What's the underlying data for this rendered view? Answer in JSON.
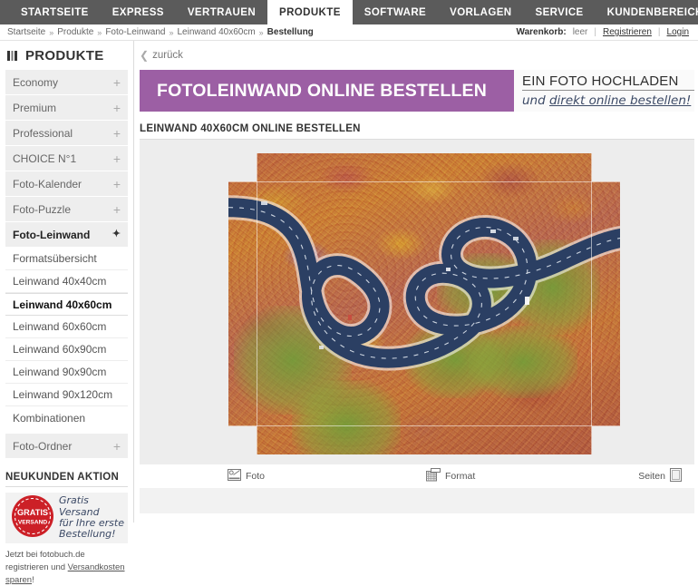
{
  "topnav": {
    "items": [
      {
        "label": "STARTSEITE",
        "active": false
      },
      {
        "label": "EXPRESS",
        "active": false
      },
      {
        "label": "VERTRAUEN",
        "active": false
      },
      {
        "label": "PRODUKTE",
        "active": true
      },
      {
        "label": "SOFTWARE",
        "active": false
      },
      {
        "label": "VORLAGEN",
        "active": false
      },
      {
        "label": "SERVICE",
        "active": false
      }
    ],
    "account_label": "KUNDENBEREICH"
  },
  "breadcrumb": {
    "items": [
      "Startseite",
      "Produkte",
      "Foto-Leinwand",
      "Leinwand 40x60cm",
      "Bestellung"
    ],
    "separator": "»",
    "cart_label": "Warenkorb:",
    "cart_value": "leer",
    "register_label": "Registrieren",
    "login_label": "Login",
    "divider": "|"
  },
  "sidebar": {
    "title": "PRODUKTE",
    "categories": [
      {
        "label": "Economy",
        "expand": "+",
        "open": false
      },
      {
        "label": "Premium",
        "expand": "+",
        "open": false
      },
      {
        "label": "Professional",
        "expand": "+",
        "open": false
      },
      {
        "label": "CHOICE N°1",
        "expand": "+",
        "open": false
      },
      {
        "label": "Foto-Kalender",
        "expand": "+",
        "open": false
      },
      {
        "label": "Foto-Puzzle",
        "expand": "+",
        "open": false
      },
      {
        "label": "Foto-Leinwand",
        "expand": "✦",
        "open": true
      }
    ],
    "subitems": [
      {
        "label": "Formatsübersicht",
        "selected": false
      },
      {
        "label": "Leinwand 40x40cm",
        "selected": false
      },
      {
        "label": "Leinwand 40x60cm",
        "selected": true
      },
      {
        "label": "Leinwand 60x60cm",
        "selected": false
      },
      {
        "label": "Leinwand 60x90cm",
        "selected": false
      },
      {
        "label": "Leinwand 90x90cm",
        "selected": false
      },
      {
        "label": "Leinwand 90x120cm",
        "selected": false
      },
      {
        "label": "Kombinationen",
        "selected": false
      }
    ],
    "trailing_category": {
      "label": "Foto-Ordner",
      "expand": "+"
    },
    "promo": {
      "title": "NEUKUNDEN AKTION",
      "stamp_line1": "GRATIS",
      "stamp_line2": "VERSAND",
      "hand_line1": "Gratis Versand",
      "hand_line2": "für Ihre erste",
      "hand_line3": "Bestellung!",
      "note_prefix": "Jetzt bei fotobuch.de registrieren und ",
      "note_link": "Versandkosten sparen",
      "note_suffix": "!"
    }
  },
  "main": {
    "back_label": "zurück",
    "back_icon": "chevron-left-icon",
    "banner_title": "FOTOLEINWAND ONLINE BESTELLEN",
    "banner_sub_line1": "EIN FOTO HOCHLADEN",
    "banner_sub_line2_pre": "und ",
    "banner_sub_line2_link": "direkt online bestellen!",
    "section_title": "LEINWAND 40X60CM ONLINE BESTELLEN",
    "tools": [
      {
        "label": "Foto",
        "icon": "photo-icon"
      },
      {
        "label": "Format",
        "icon": "format-icon"
      },
      {
        "label": "Seiten",
        "icon": "pages-icon"
      }
    ]
  },
  "colors": {
    "nav_bg": "#5b5b5b",
    "banner_purple": "#9c5fa4",
    "stamp_red": "#cc2027",
    "stage_bg": "#ededed",
    "menu_bg": "#eeeeee",
    "hand_blue": "#3c4a66"
  }
}
